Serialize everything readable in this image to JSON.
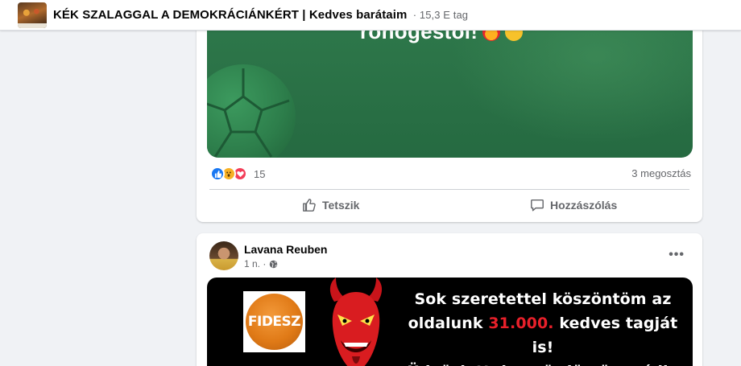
{
  "group_header": {
    "name": "KÉK SZALAGGAL A DEMOKRÁCIÁNKÉRT | Kedves barátaim",
    "members": "· 15,3 E tag"
  },
  "post1": {
    "media_caption": "röhögéstől!",
    "reaction_count": "15",
    "shares": "3 megosztás",
    "actions": {
      "like": "Tetszik",
      "comment": "Hozzászólás"
    }
  },
  "post2": {
    "author": "Lavana Reuben",
    "time": "1 n. ·",
    "image": {
      "logo_text": "FIDESZ",
      "line1": "Sok szeretettel  köszöntöm  az",
      "line2_pre": "oldalunk ",
      "line2_highlight": "31.000.",
      "line2_post": " kedves tagját  is!",
      "line3": "Üdvözlettel:  az  ördög  ügyvédje"
    }
  },
  "colors": {
    "accent": "#1877f2",
    "highlight_red": "#e8202a",
    "media_green": "#2a7146"
  }
}
